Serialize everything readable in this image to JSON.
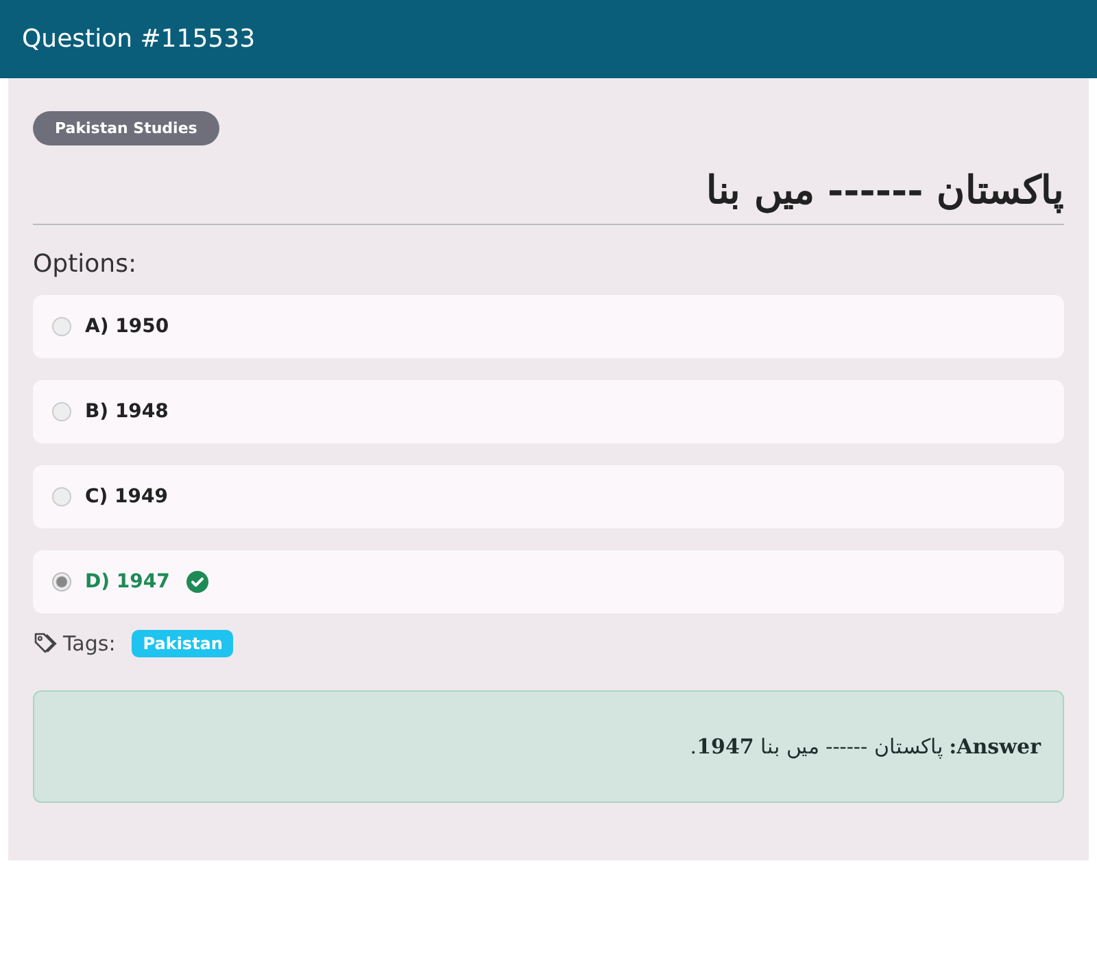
{
  "header": {
    "title": "Question #115533"
  },
  "category": "Pakistan Studies",
  "question": "پاکستان ------ میں بنا",
  "options_label": "Options:",
  "options": [
    {
      "label": "A) 1950",
      "selected": false,
      "correct": false
    },
    {
      "label": "B) 1948",
      "selected": false,
      "correct": false
    },
    {
      "label": "C) 1949",
      "selected": false,
      "correct": false
    },
    {
      "label": "D) 1947",
      "selected": true,
      "correct": true
    }
  ],
  "tags_label": "Tags:",
  "tags": [
    "Pakistan"
  ],
  "answer": "**Answer:** پاکستان ------ میں بنا **1947**."
}
